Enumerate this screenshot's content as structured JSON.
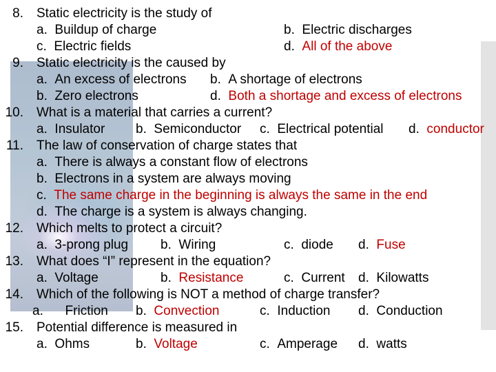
{
  "colors": {
    "correct_answer": "#c00000",
    "text": "#000000",
    "side_bar": "#e3e3e3"
  },
  "questions": [
    {
      "num": "8.",
      "text": "Static electricity is the study of",
      "option_rows": [
        [
          {
            "label": "a.",
            "text": "Buildup of charge",
            "correct": false
          },
          {
            "label": "b.",
            "text": "Electric discharges",
            "correct": false
          }
        ],
        [
          {
            "label": "c.",
            "text": "Electric fields",
            "correct": false
          },
          {
            "label": "d.",
            "text": "All of the above",
            "correct": true
          }
        ]
      ]
    },
    {
      "num": "9.",
      "text": "Static electricity is the caused by",
      "option_rows": [
        [
          {
            "label": "a.",
            "text": "An excess of electrons",
            "correct": false
          },
          {
            "label": "b.",
            "text": "A shortage of electrons",
            "correct": false
          }
        ],
        [
          {
            "label": "b.",
            "text": "Zero electrons",
            "correct": false
          },
          {
            "label": "d.",
            "text": "Both a shortage and excess of electrons",
            "correct": true
          }
        ]
      ]
    },
    {
      "num": "10.",
      "text": "What is a material that carries a current?",
      "option_rows": [
        [
          {
            "label": "a.",
            "text": "Insulator",
            "correct": false
          },
          {
            "label": "b.",
            "text": "Semiconductor",
            "correct": false
          },
          {
            "label": "c.",
            "text": "Electrical potential",
            "correct": false
          },
          {
            "label": "d.",
            "text": "conductor",
            "correct": true
          }
        ]
      ]
    },
    {
      "num": "11.",
      "text": "The law of conservation of charge states that",
      "option_rows": [
        [
          {
            "label": "a.",
            "text": "There is always a constant flow of electrons",
            "correct": false
          }
        ],
        [
          {
            "label": "b.",
            "text": "Electrons in a system are always moving",
            "correct": false
          }
        ],
        [
          {
            "label": "c.",
            "text": "The same charge in the beginning is always the same in the end",
            "correct": true
          }
        ],
        [
          {
            "label": "d.",
            "text": "The charge is a system is always changing.",
            "correct": false
          }
        ]
      ]
    },
    {
      "num": "12.",
      "text": "Which melts to protect a circuit?",
      "option_rows": [
        [
          {
            "label": "a.",
            "text": "3-prong plug",
            "correct": false
          },
          {
            "label": "b.",
            "text": "Wiring",
            "correct": false
          },
          {
            "label": "c.",
            "text": "diode",
            "correct": false
          },
          {
            "label": "d.",
            "text": "Fuse",
            "correct": true
          }
        ]
      ]
    },
    {
      "num": "13.",
      "text": "What does “I” represent in the equation?",
      "option_rows": [
        [
          {
            "label": "a.",
            "text": "Voltage",
            "correct": false
          },
          {
            "label": "b.",
            "text": "Resistance",
            "correct": true
          },
          {
            "label": "c.",
            "text": "Current",
            "correct": false
          },
          {
            "label": "d.",
            "text": "Kilowatts",
            "correct": false
          }
        ]
      ]
    },
    {
      "num": "14.",
      "text": "Which of the following is NOT a method of charge transfer?",
      "option_rows": [
        [
          {
            "label": "a.",
            "text": "Friction",
            "correct": false
          },
          {
            "label": "b.",
            "text": "Convection",
            "correct": true
          },
          {
            "label": "c.",
            "text": "Induction",
            "correct": false
          },
          {
            "label": "d.",
            "text": "Conduction",
            "correct": false
          }
        ]
      ]
    },
    {
      "num": "15.",
      "text": "Potential difference is measured in",
      "option_rows": [
        [
          {
            "label": "a.",
            "text": "Ohms",
            "correct": false
          },
          {
            "label": "b.",
            "text": "Voltage",
            "correct": true
          },
          {
            "label": "c.",
            "text": "Amperage",
            "correct": false
          },
          {
            "label": "d.",
            "text": "watts",
            "correct": false
          }
        ]
      ]
    }
  ]
}
